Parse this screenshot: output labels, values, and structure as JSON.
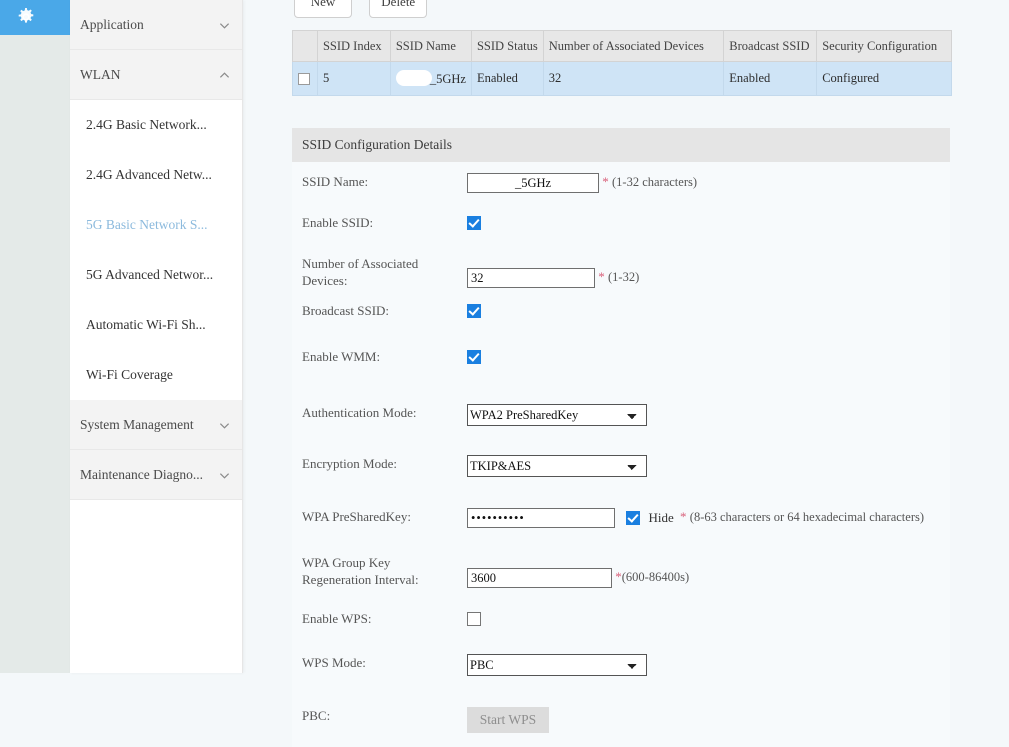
{
  "nav_rail": {
    "icon": "gear-icon"
  },
  "sidebar": {
    "groups": [
      {
        "label": "Application",
        "chevron": "chevron-down-icon",
        "expanded": false
      },
      {
        "label": "WLAN",
        "chevron": "chevron-up-icon",
        "expanded": true
      }
    ],
    "items": [
      {
        "label": "2.4G Basic Network...",
        "selected": false
      },
      {
        "label": "2.4G Advanced Netw...",
        "selected": false
      },
      {
        "label": "5G Basic Network S...",
        "selected": true
      },
      {
        "label": "5G Advanced Networ...",
        "selected": false
      },
      {
        "label": "Automatic Wi-Fi Sh...",
        "selected": false
      },
      {
        "label": "Wi-Fi Coverage",
        "selected": false
      }
    ],
    "groups_bottom": [
      {
        "label": "System Management",
        "chevron": "chevron-down-icon"
      },
      {
        "label": "Maintenance Diagno...",
        "chevron": "chevron-down-icon"
      }
    ]
  },
  "toolbar": {
    "new_label": "New",
    "delete_label": "Delete"
  },
  "ssid_table": {
    "columns": [
      "",
      "SSID Index",
      "SSID Name",
      "SSID Status",
      "Number of Associated Devices",
      "Broadcast SSID",
      "Security Configuration"
    ],
    "rows": [
      {
        "checked": false,
        "index": "5",
        "name": "_5GHz",
        "status": "Enabled",
        "associated_devices": "32",
        "broadcast": "Enabled",
        "security": "Configured"
      }
    ]
  },
  "details": {
    "header": "SSID Configuration Details",
    "ssid_name": {
      "label": "SSID Name:",
      "value": "_5GHz",
      "required": "*",
      "hint": "(1-32 characters)"
    },
    "enable_ssid": {
      "label": "Enable SSID:",
      "checked": true
    },
    "assoc_devices": {
      "label": "Number of Associated Devices:",
      "label_line1": "Number of Associated",
      "label_line2": "Devices:",
      "value": "32",
      "required": "*",
      "hint": "(1-32)"
    },
    "broadcast_ssid": {
      "label": "Broadcast SSID:",
      "checked": true
    },
    "enable_wmm": {
      "label": "Enable WMM:",
      "checked": true
    },
    "auth_mode": {
      "label": "Authentication Mode:",
      "value": "WPA2 PreSharedKey",
      "options": [
        "WPA2 PreSharedKey"
      ]
    },
    "encryption_mode": {
      "label": "Encryption Mode:",
      "value": "TKIP&AES",
      "options": [
        "TKIP&AES"
      ]
    },
    "wpa_key": {
      "label": "WPA PreSharedKey:",
      "value": "••••••••••",
      "hide_label": "Hide",
      "hide_checked": true,
      "required": "*",
      "hint": "(8-63 characters or 64 hexadecimal characters)"
    },
    "wpa_interval": {
      "label": "WPA Group Key Regeneration Interval:",
      "label_line1": "WPA Group Key",
      "label_line2": "Regeneration Interval:",
      "value": "3600",
      "required": "*",
      "hint": "(600-86400s)"
    },
    "enable_wps": {
      "label": "Enable WPS:",
      "checked": false
    },
    "wps_mode": {
      "label": "WPS Mode:",
      "value": "PBC",
      "options": [
        "PBC"
      ]
    },
    "pbc": {
      "label": "PBC:",
      "button_label": "Start WPS",
      "disabled": true
    }
  },
  "colors": {
    "accent_blue": "#4aa8e8",
    "selected_item": "#8cbadd",
    "row_highlight": "#cfe4f6",
    "required_red": "#d9607a",
    "checkbox_blue": "#1a7fe0"
  }
}
